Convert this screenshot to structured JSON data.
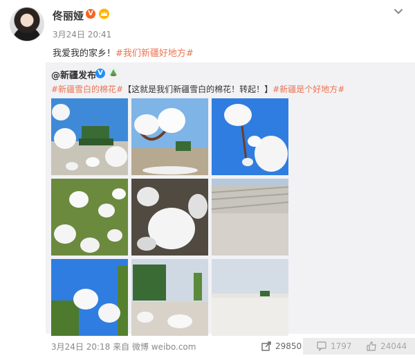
{
  "post": {
    "username": "佟丽娅",
    "timestamp": "3月24日 20:41",
    "text_plain": "我爱我的家乡！",
    "text_tag": "#我们新疆好地方#"
  },
  "retweet": {
    "username": "@新疆发布",
    "tag1": "#新疆雪白的棉花#",
    "text_mid": "【这就是我们新疆雪白的棉花！转起！】",
    "tag2": "#新疆是个好地方#",
    "photos": [
      {
        "scene": "cotton-harvester-blue-sky"
      },
      {
        "scene": "cotton-boll-closeup-field"
      },
      {
        "scene": "cotton-boll-blue-sky"
      },
      {
        "scene": "cotton-plants-green-leaves"
      },
      {
        "scene": "cotton-boll-macro"
      },
      {
        "scene": "cotton-field-rows"
      },
      {
        "scene": "cotton-plant-blue-sky"
      },
      {
        "scene": "cotton-harvester-field"
      },
      {
        "scene": "cotton-field-horizon"
      }
    ]
  },
  "footer": {
    "timestamp_source": "3月24日 20:18 来自 微博 weibo.com",
    "share_count": "29850",
    "comment_count": "1797",
    "like_count": "24044"
  },
  "icons": {
    "verified_orange": "#f7631f",
    "verified_blue": "#1e90ff",
    "tag_color": "#eb7350"
  }
}
